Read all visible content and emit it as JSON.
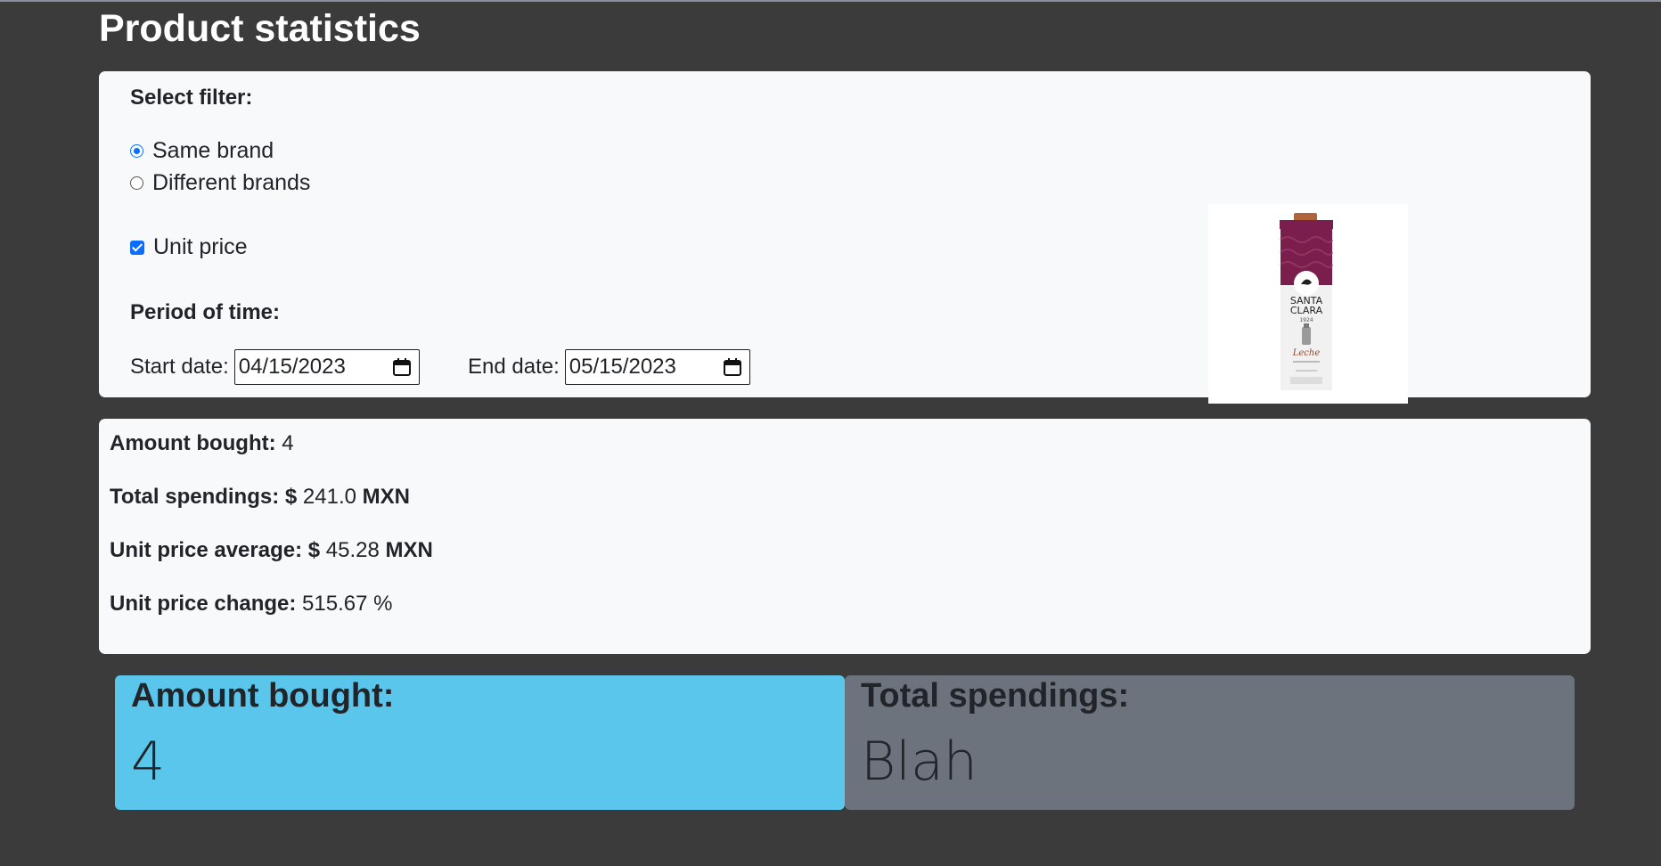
{
  "header": {
    "title": "Product statistics"
  },
  "filters": {
    "select_label": "Select filter:",
    "radio_same": "Same brand",
    "radio_different": "Different brands",
    "selected": "Same brand",
    "unit_price_label": "Unit price",
    "unit_price_checked": true,
    "period_label": "Period of time:",
    "start_label": "Start date:",
    "start_value": "04/15/2023",
    "end_label": "End date:",
    "end_value": "05/15/2023"
  },
  "product": {
    "brand_line1": "SANTA",
    "brand_line2": "CLARA",
    "brand_sub": "1924",
    "product_name": "Leche",
    "colors": {
      "carton_top": "#7a1f4d",
      "accent": "#8a4a2a"
    }
  },
  "stats": {
    "amount_label": "Amount bought:",
    "amount_value": "4",
    "total_label": "Total spendings:",
    "total_currency": "$",
    "total_value": "241.0",
    "total_unit": "MXN",
    "avg_label": "Unit price average:",
    "avg_currency": "$",
    "avg_value": "45.28",
    "avg_unit": "MXN",
    "change_label": "Unit price change:",
    "change_value": "515.67 %"
  },
  "tiles": {
    "amount_title": "Amount bought:",
    "amount_value": "4",
    "total_title": "Total spendings:",
    "total_value": "Blah"
  }
}
